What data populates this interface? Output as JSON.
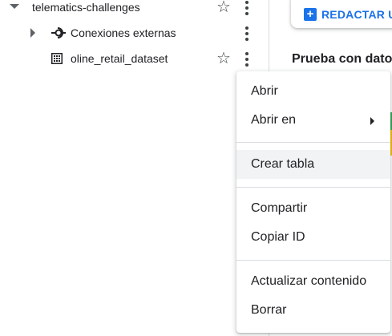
{
  "explorer": {
    "items": [
      {
        "label": "telematics-challenges",
        "icon": "project-caret-down-icon"
      },
      {
        "label": "Conexiones externas",
        "icon": "external-connection-icon"
      },
      {
        "label": "oline_retail_dataset",
        "icon": "dataset-grid-icon"
      }
    ]
  },
  "right_panel": {
    "compose_label": "REDACTAR U",
    "section_title": "Prueba con datos",
    "accent_colors": [
      "#34a853",
      "#fbbc04"
    ]
  },
  "context_menu": {
    "items": [
      {
        "label": "Abrir"
      },
      {
        "label": "Abrir en",
        "has_submenu": true
      },
      {
        "label": "Crear tabla",
        "highlighted": true
      },
      {
        "label": "Compartir"
      },
      {
        "label": "Copiar ID"
      },
      {
        "label": "Actualizar contenido"
      },
      {
        "label": "Borrar"
      }
    ]
  },
  "colors": {
    "accent_blue": "#1a73e8",
    "menu_hover": "#f1f3f4",
    "divider": "#dadce0"
  }
}
